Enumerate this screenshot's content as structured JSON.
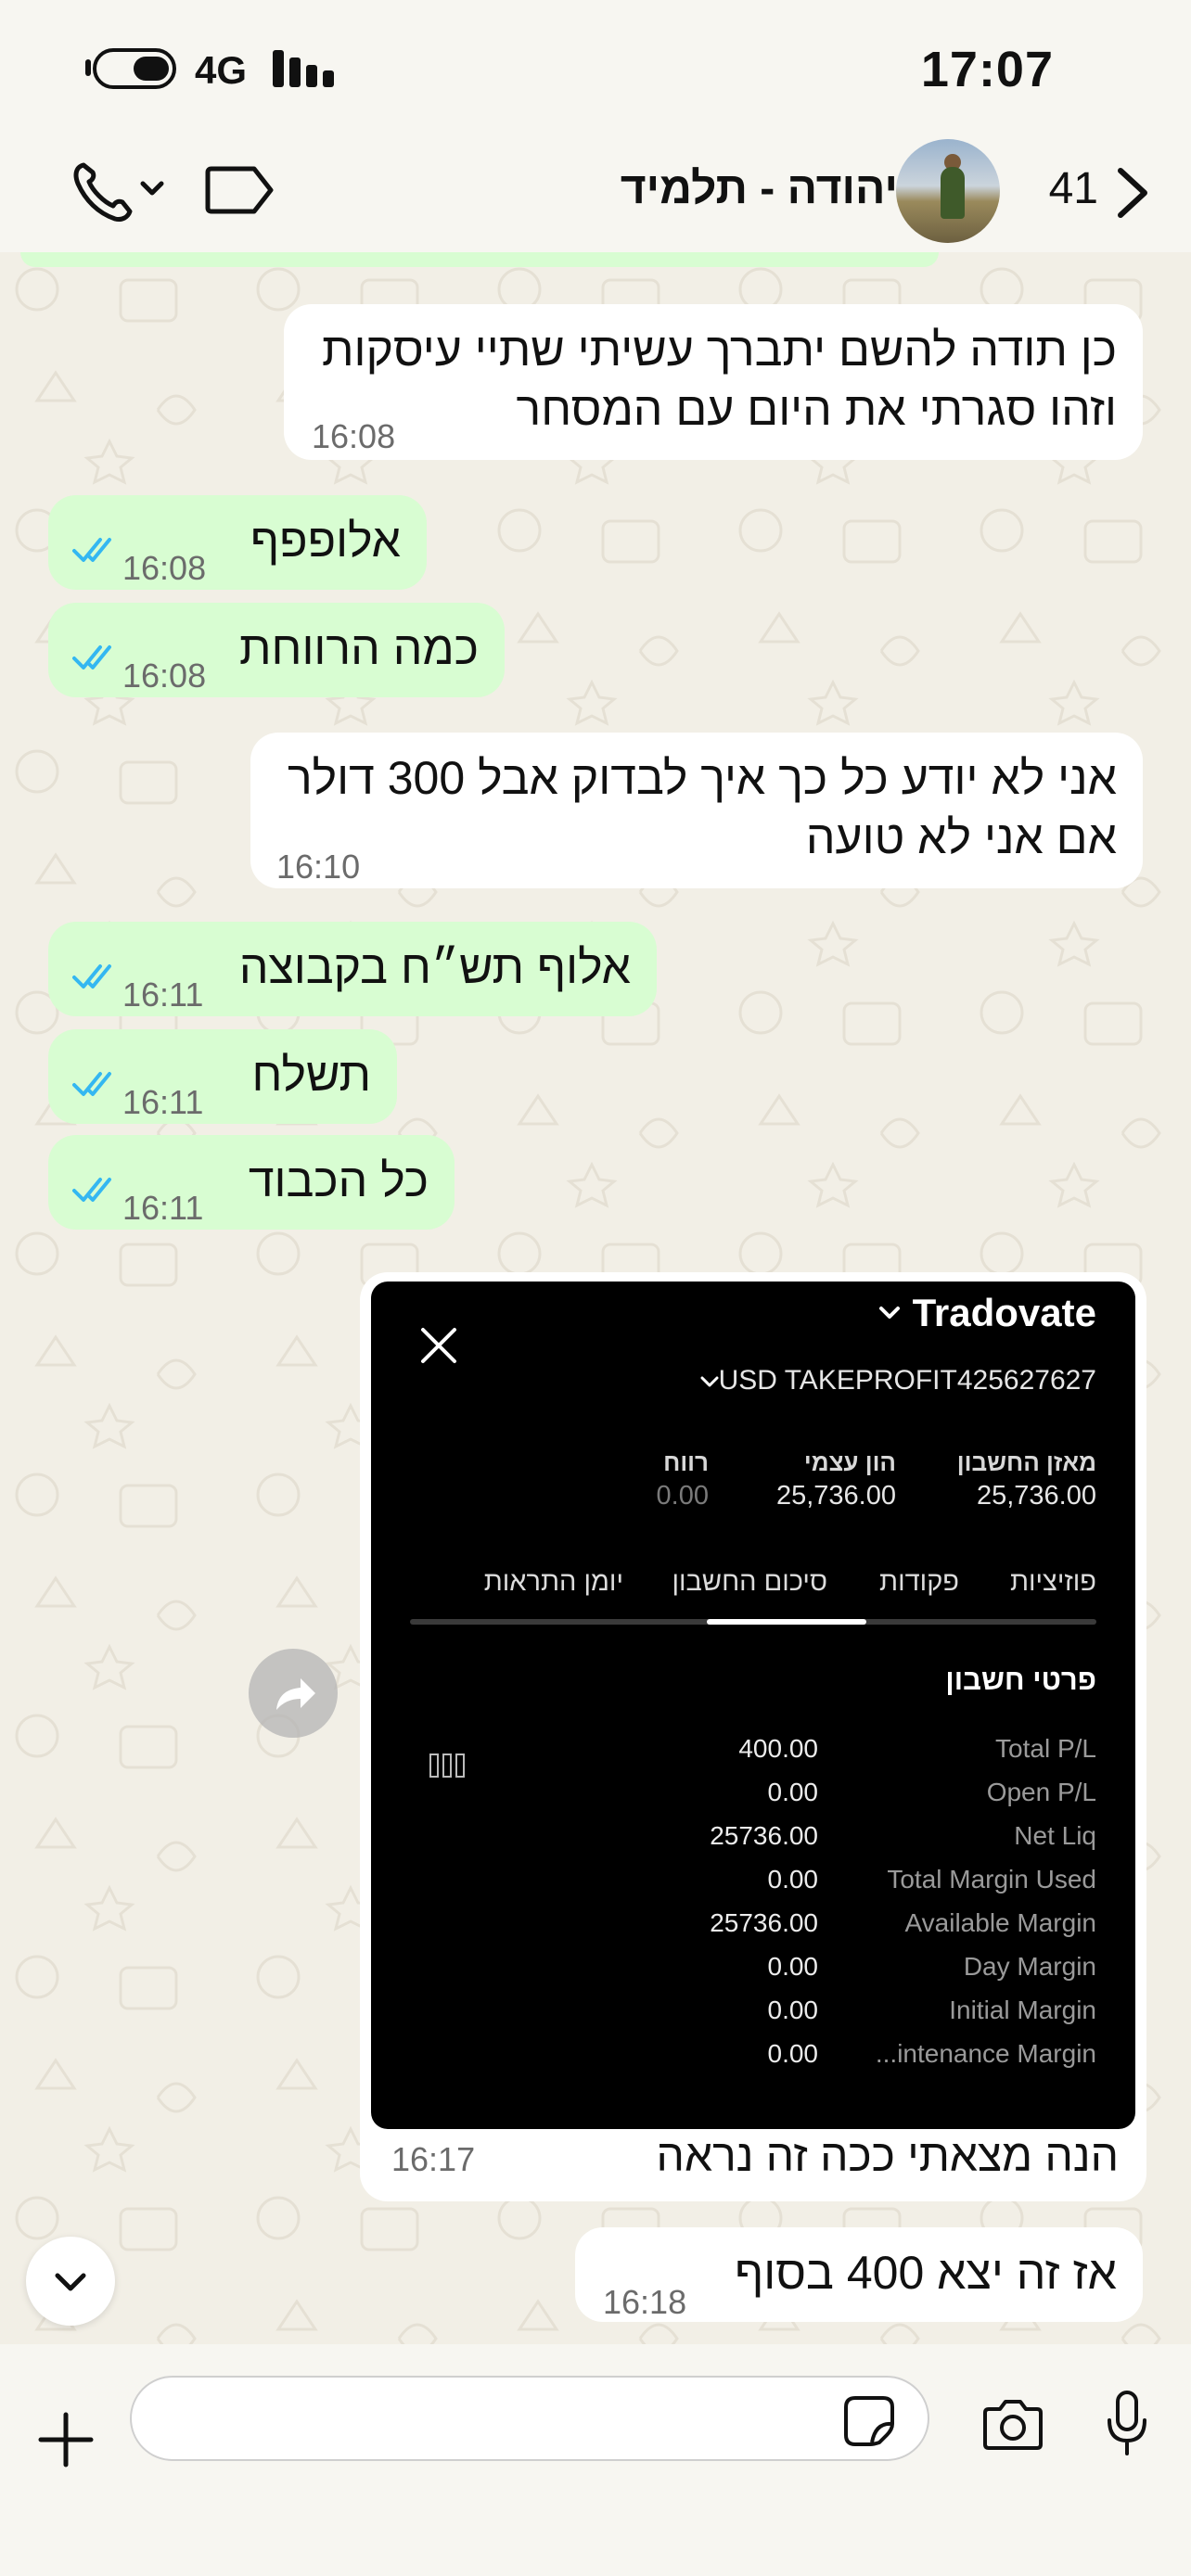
{
  "status_bar": {
    "time": "17:07",
    "network": "4G"
  },
  "header": {
    "contact_name": "יהודה - תלמיד",
    "unread_count": "41"
  },
  "messages": [
    {
      "direction": "incoming",
      "lines": [
        "כן תודה להשם יתברך עשיתי שתיי עיסקות",
        "וזהו סגרתי את היום עם המסחר"
      ],
      "time": "16:08"
    },
    {
      "direction": "outgoing",
      "lines": [
        "אלופפף"
      ],
      "time": "16:08",
      "status": "read"
    },
    {
      "direction": "outgoing",
      "lines": [
        "כמה הרווחת"
      ],
      "time": "16:08",
      "status": "read"
    },
    {
      "direction": "incoming",
      "lines": [
        "אני לא יודע כל כך איך לבדוק אבל 300 דולר",
        "אם אני לא טועה"
      ],
      "time": "16:10"
    },
    {
      "direction": "outgoing",
      "lines": [
        "אלוף תש״ח בקבוצה"
      ],
      "time": "16:11",
      "status": "read"
    },
    {
      "direction": "outgoing",
      "lines": [
        "תשלח"
      ],
      "time": "16:11",
      "status": "read"
    },
    {
      "direction": "outgoing",
      "lines": [
        "כל הכבוד"
      ],
      "time": "16:11",
      "status": "read"
    }
  ],
  "image_message": {
    "caption": "הנה מצאתי ככה זה נראה",
    "time": "16:17",
    "screenshot": {
      "brand": "Tradovate",
      "account": "USD TAKEPROFIT425627627",
      "kpis": [
        {
          "label": "מאזן החשבון",
          "value": "25,736.00"
        },
        {
          "label": "הון עצמי",
          "value": "25,736.00"
        },
        {
          "label": "רווח",
          "value": "0.00"
        }
      ],
      "tabs": [
        "פוזיציות",
        "פקודות",
        "סיכום החשבון",
        "יומן התראות"
      ],
      "active_tab": "סיכום החשבון",
      "section_title": "פרטי חשבון",
      "rows": [
        {
          "label": "Total P/L",
          "value": "400.00"
        },
        {
          "label": "Open P/L",
          "value": "0.00"
        },
        {
          "label": "Net Liq",
          "value": "25736.00"
        },
        {
          "label": "Total Margin Used",
          "value": "0.00"
        },
        {
          "label": "Available Margin",
          "value": "25736.00"
        },
        {
          "label": "Day Margin",
          "value": "0.00"
        },
        {
          "label": "Initial Margin",
          "value": "0.00"
        },
        {
          "label": "...intenance Margin",
          "value": "0.00"
        }
      ]
    }
  },
  "last_message": {
    "direction": "incoming",
    "text": "אז זה יצא 400 בסוף",
    "time": "16:18"
  },
  "composer": {
    "placeholder": ""
  },
  "colors": {
    "outgoing_bubble": "#d8fdd2",
    "incoming_bubble": "#ffffff",
    "read_ticks": "#34b7f1",
    "background": "#f2efe6"
  }
}
